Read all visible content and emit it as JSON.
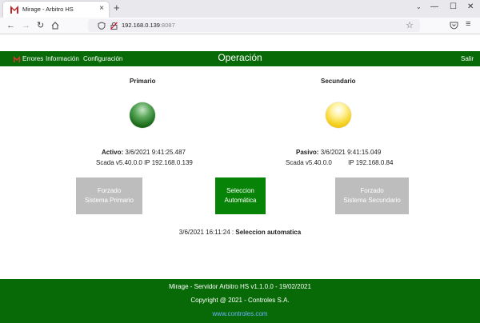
{
  "browser": {
    "tab_title": "Mirage - Arbitro HS",
    "tab_close": "×",
    "new_tab": "+",
    "window_minimize": "—",
    "window_maximize": "☐",
    "window_close": "✕",
    "url_host": "192.168.0.139",
    "url_port": ":8087"
  },
  "header": {
    "menu": {
      "errors": "Errores",
      "info": "Información",
      "config": "Configuración"
    },
    "title": "Operación",
    "logout": "Salir"
  },
  "primary": {
    "title": "Primario",
    "led_color": "#1e6e1e",
    "state_label": "Activo:",
    "state_time": "3/6/2021 9:41:25.487",
    "scada": "Scada v5.40.0.0",
    "ip": "IP 192.168.0.139"
  },
  "secondary": {
    "title": "Secundario",
    "led_color": "#f6d324",
    "state_label": "Pasivo:",
    "state_time": "3/6/2021 9:41:15.049",
    "scada": "Scada v5.40.0.0",
    "ip": "IP 192.168.0.84"
  },
  "buttons": {
    "force_primary_l1": "Forzado",
    "force_primary_l2": "Sistema Primario",
    "auto_l1": "Seleccion",
    "auto_l2": "Automática",
    "force_secondary_l1": "Forzado",
    "force_secondary_l2": "Sistema Secundario"
  },
  "status": {
    "time": "3/6/2021 16:11:24 :",
    "message": "Seleccion automatica"
  },
  "footer": {
    "line1": "Mirage - Servidor Arbitro HS v1.1.0.0 - 19/02/2021",
    "line2": "Copyright @ 2021 - Controles S.A.",
    "link": "www.controles.com"
  },
  "colors": {
    "brand_green": "#076a07",
    "button_green": "#078407",
    "button_grey": "#bdbdbd"
  }
}
